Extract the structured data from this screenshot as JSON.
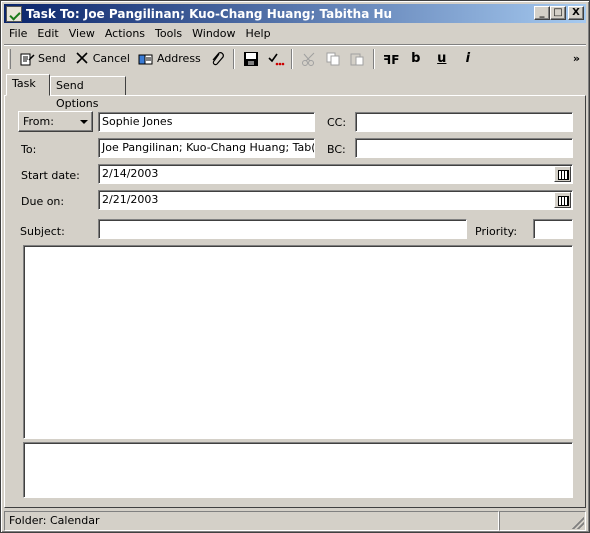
{
  "window": {
    "title": "Task To: Joe Pangilinan; Kuo-Chang Huang; Tabitha Hu",
    "minimize": "_",
    "maximize": "□",
    "close": "X"
  },
  "menu": [
    {
      "label": "File"
    },
    {
      "label": "Edit"
    },
    {
      "label": "View"
    },
    {
      "label": "Actions"
    },
    {
      "label": "Tools"
    },
    {
      "label": "Window"
    },
    {
      "label": "Help"
    }
  ],
  "toolbar": {
    "send_label": "Send",
    "cancel_label": "Cancel",
    "address_label": "Address",
    "bold_glyph": "b",
    "underline_glyph": "u",
    "italic_glyph": "i",
    "more_glyph": "»"
  },
  "tabs": [
    {
      "label": "Task",
      "active": true
    },
    {
      "label": "Send Options",
      "active": false
    }
  ],
  "form": {
    "from_button": "From:",
    "from_value": "Sophie Jones",
    "to_label": "To:",
    "to_value": "Joe Pangilinan; Kuo-Chang Huang; Tab(...)",
    "cc_label": "CC:",
    "cc_value": "",
    "bc_label": "BC:",
    "bc_value": "",
    "start_label": "Start date:",
    "start_value": "2/14/2003",
    "due_label": "Due on:",
    "due_value": "2/21/2003",
    "subject_label": "Subject:",
    "subject_value": "",
    "priority_label": "Priority:",
    "priority_value": ""
  },
  "status": {
    "folder": "Folder: Calendar",
    "pane2": ""
  }
}
